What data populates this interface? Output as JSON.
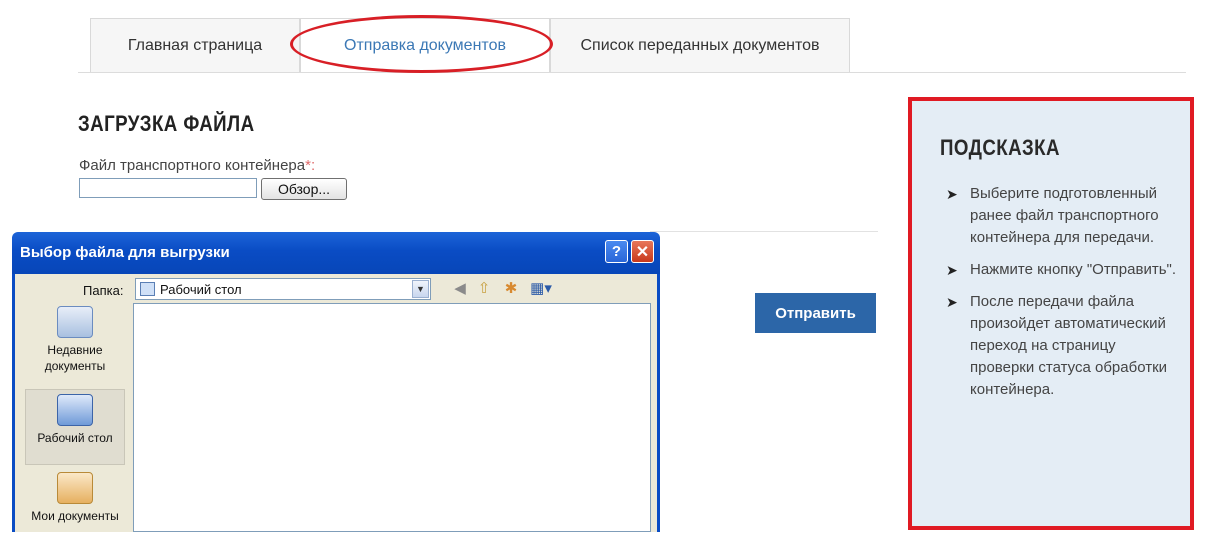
{
  "tabs": [
    {
      "label": "Главная страница"
    },
    {
      "label": "Отправка документов"
    },
    {
      "label": "Список переданных документов"
    }
  ],
  "upload": {
    "title": "ЗАГРУЗКА ФАЙЛА",
    "field_label": "Файл транспортного контейнера",
    "required_mark": "*:",
    "file_value": "",
    "browse_label": "Обзор..."
  },
  "send_label": "Отправить",
  "hint": {
    "title": "ПОДСКАЗКА",
    "items": [
      "Выберите подготовленный ранее файл транспортного контейнера для передачи.",
      "Нажмите кнопку \"Отправить\".",
      "После передачи файла произойдет автоматический переход на страницу проверки статуса обработки контейнера."
    ]
  },
  "dialog": {
    "title": "Выбор файла для выгрузки",
    "help": "?",
    "close": "✕",
    "folder_label": "Папка:",
    "folder_value": "Рабочий стол",
    "toolbar_icons": [
      "back-icon",
      "up-folder-icon",
      "new-folder-icon",
      "view-menu-icon"
    ],
    "places": [
      {
        "label": "Недавние документы",
        "icon": "recent-documents-icon"
      },
      {
        "label": "Рабочий стол",
        "icon": "desktop-icon"
      },
      {
        "label": "Мои документы",
        "icon": "my-documents-icon"
      }
    ]
  },
  "colors": {
    "accent_blue": "#2c66a8",
    "highlight_red": "#e01a23",
    "hint_bg": "#e4edf5",
    "xp_title": "#0a4cc4"
  }
}
